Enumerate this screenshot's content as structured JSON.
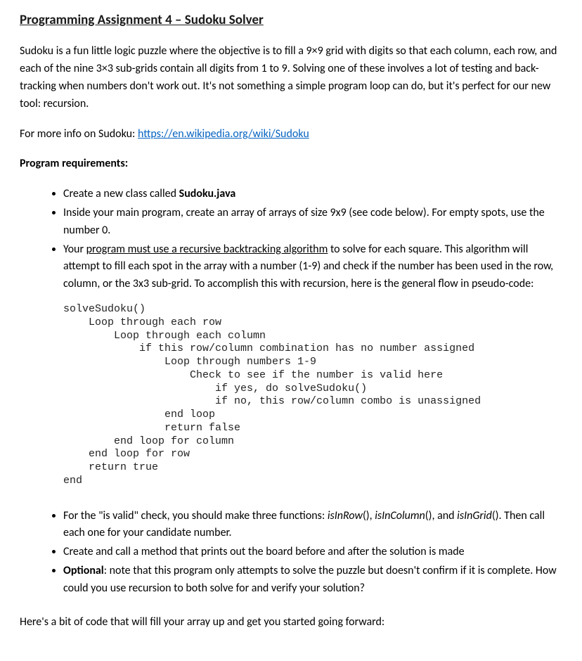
{
  "title": "Programming Assignment 4 – Sudoku Solver",
  "intro": "Sudoku is a fun little logic puzzle where the objective is to fill a 9×9 grid with digits so that each column, each row, and each of the nine 3×3 sub-grids contain all digits from 1 to 9. Solving one of these involves a lot of testing and back-tracking when numbers don't work out. It's not something a simple program loop can do, but it's perfect for our new tool: recursion.",
  "more_info_prefix": "For more info on Sudoku: ",
  "more_info_link": "https://en.wikipedia.org/wiki/Sudoku",
  "requirements_heading": "Program requirements:",
  "req1_prefix": "Create a new class called ",
  "req1_class": "Sudoku.java",
  "req2": "Inside your main program, create an array of arrays of size 9x9 (see code below). For empty spots, use the number 0.",
  "req3_prefix": "Your ",
  "req3_underline": "program must use a recursive backtracking algorithm",
  "req3_suffix": " to solve for each square. This algorithm will attempt to fill each spot in the array with a number (1-9) and check if the number has been used in the row, column, or the 3x3 sub-grid. To accomplish this with recursion, here is the general flow in pseudo-code:",
  "pseudocode": "solveSudoku()\n    Loop through each row\n        Loop through each column\n            if this row/column combination has no number assigned\n                Loop through numbers 1-9\n                    Check to see if the number is valid here\n                        if yes, do solveSudoku()\n                        if no, this row/column combo is unassigned\n                end loop\n                return false\n        end loop for column\n    end loop for row\n    return true\nend",
  "req4_prefix": "For the \"is valid\" check, you should make three functions: ",
  "req4_f1": "isInRow",
  "req4_p1": "(), ",
  "req4_f2": "isInColumn",
  "req4_p2": "(), and ",
  "req4_f3": "isInGrid",
  "req4_suffix": "(). Then call each one for your candidate number.",
  "req5": "Create and call a method that prints out the board before and after the solution is made",
  "req6_bold": "Optional",
  "req6_rest": ": note that this program only attempts to solve the puzzle but doesn't confirm if it is complete. How could you use recursion to both solve for and verify your solution?",
  "closing": "Here's a bit of code that will fill your array up and get you started going forward:"
}
